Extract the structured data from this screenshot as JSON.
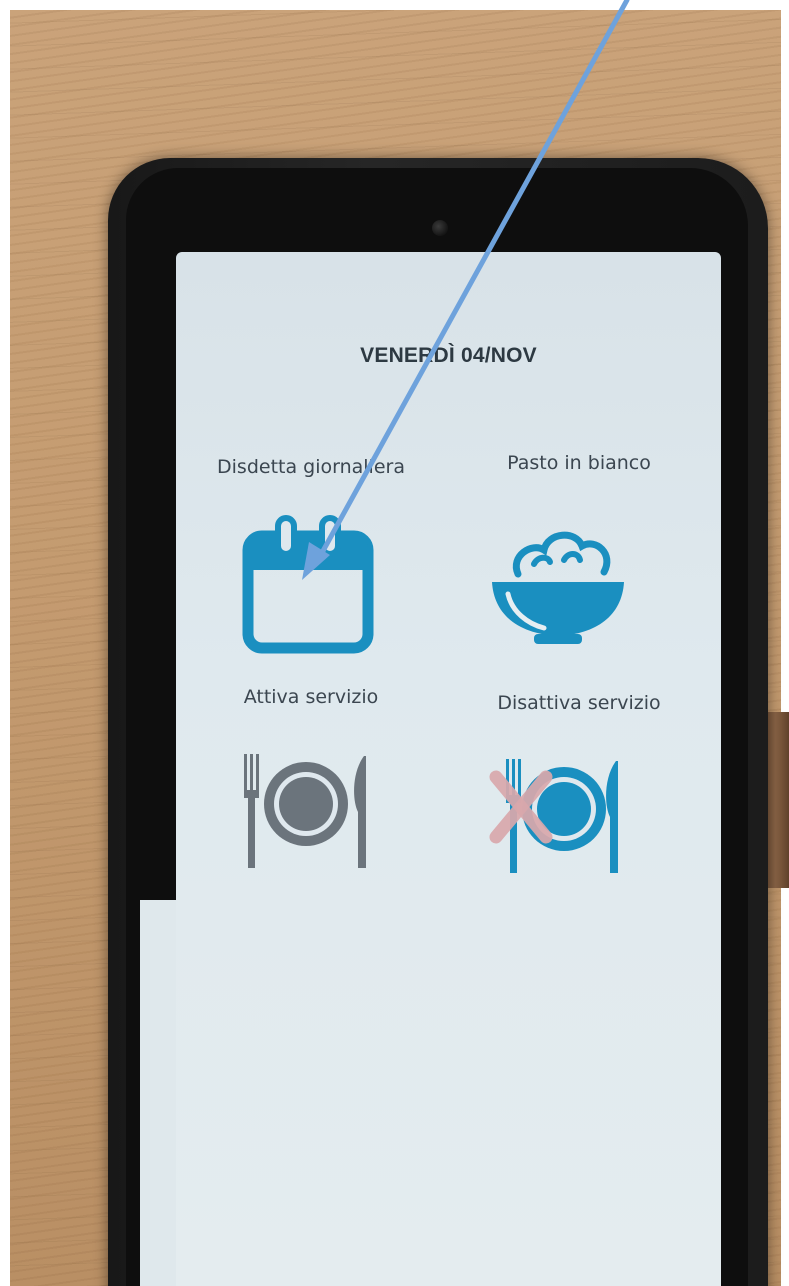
{
  "header": {
    "day_title": "VENERDÌ 04/NOV"
  },
  "options": [
    {
      "label": "Disdetta giornaliera",
      "icon": "calendar-icon"
    },
    {
      "label": "Pasto in bianco",
      "icon": "rice-bowl-icon"
    },
    {
      "label": "Attiva servizio",
      "icon": "plate-cutlery-icon"
    },
    {
      "label": "Disattiva servizio",
      "icon": "plate-cutlery-crossed-icon"
    }
  ],
  "colors": {
    "accent": "#1a8fc0",
    "inactive": "#6b747c",
    "cross": "#d9a8ac",
    "annotation_arrow": "#6ea2dc",
    "screen_bg": "#dfe9ee"
  }
}
